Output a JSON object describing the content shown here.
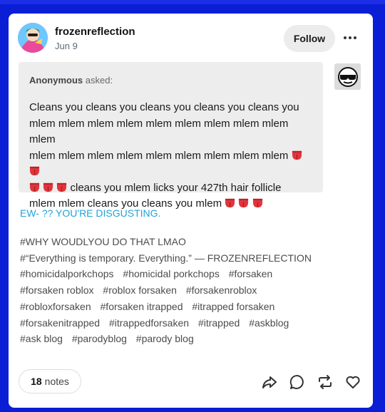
{
  "post": {
    "username": "frozenreflection",
    "date": "Jun 9",
    "follow_label": "Follow",
    "ask": {
      "asker": "Anonymous",
      "asked_label": "asked:",
      "question_line1": "Cleans you cleans you cleans you cleans you cleans you",
      "question_line2": "mlem mlem mlem mlem mlem mlem mlem mlem mlem mlem",
      "question_line3": "mlem mlem mlem mlem mlem mlem mlem mlem mlem",
      "question_line4": " cleans you mlem licks your 427th hair follicle",
      "question_line5": "mlem mlem cleans you cleans you mlem",
      "emoji": "tongue-emoji"
    },
    "answer": "EW- ?? YOU'RE DISGUSTING.",
    "tags": [
      "#WHY WOUDLYOU DO THAT LMAO",
      "#“Everything is temporary. Everything.” — FROZENREFLECTION",
      "#homicidalporkchops",
      "#homicidal porkchops",
      "#forsaken",
      "#forsaken roblox",
      "#roblox forsaken",
      "#forsakenroblox",
      "#robloxforsaken",
      "#forsaken itrapped",
      "#itrapped forsaken",
      "#forsakenitrapped",
      "#itrappedforsaken",
      "#itrapped",
      "#askblog",
      "#ask blog",
      "#parodyblog",
      "#parody blog"
    ],
    "notes_count": "18",
    "notes_label": "notes",
    "actions": [
      "share-icon",
      "reply-icon",
      "reblog-icon",
      "like-icon"
    ]
  },
  "colors": {
    "background": "#0a1ed6",
    "answer_text": "#1fa4d8",
    "ask_box": "#ededed"
  }
}
